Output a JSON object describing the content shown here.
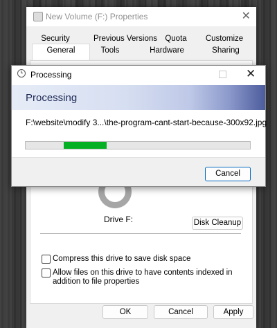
{
  "properties_window": {
    "title": "New Volume (F:) Properties",
    "close_glyph": "✕",
    "tabs_row1": [
      "Security",
      "Previous Versions",
      "Quota",
      "Customize"
    ],
    "tabs_row2": [
      "General",
      "Tools",
      "Hardware",
      "Sharing"
    ],
    "active_tab": "General",
    "drive_label": "Drive F:",
    "disk_cleanup_label": "Disk Cleanup",
    "compress_label": "Compress this drive to save disk space",
    "compress_checked": false,
    "index_label": "Allow files on this drive to have contents indexed in addition to file properties",
    "index_checked": false,
    "buttons": {
      "ok": "OK",
      "cancel": "Cancel",
      "apply": "Apply"
    }
  },
  "processing_dialog": {
    "title": "Processing",
    "banner_heading": "Processing",
    "current_file": "F:\\website\\modify 3...\\the-program-cant-start-because-300x92.jpg",
    "progress": {
      "start_fraction": 0.17,
      "end_fraction": 0.36,
      "color": "#06b025",
      "indeterminate": true
    },
    "cancel_label": "Cancel",
    "close_glyph": "✕"
  }
}
